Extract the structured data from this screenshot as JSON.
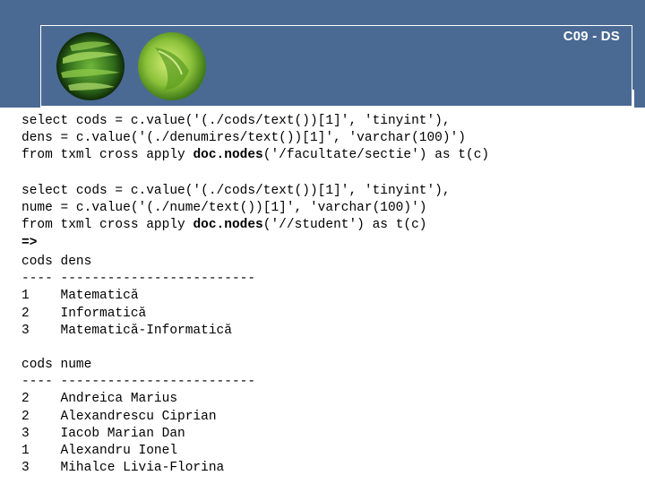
{
  "slide": {
    "title": "C09 - DS"
  },
  "query1": {
    "line1": "select cods = c.value('(./cods/text())[1]', 'tinyint'),",
    "line2": "dens = c.value('(./denumires/text())[1]', 'varchar(100)')",
    "line3_a": "from txml cross apply ",
    "line3_kw": "doc.nodes",
    "line3_b": "('/facultate/sectie') as t(c)"
  },
  "query2": {
    "line1": "select cods = c.value('(./cods/text())[1]', 'tinyint'),",
    "line2": "nume = c.value('(./nume/text())[1]', 'varchar(100)')",
    "line3_a": "from txml cross apply ",
    "line3_kw": "doc.nodes",
    "line3_b": "('//student') as t(c)",
    "arrow": "=>"
  },
  "result1": {
    "header": "cods dens",
    "separator": "---- -------------------------",
    "rows": [
      "1    Matematică",
      "2    Informatică",
      "3    Matematică-Informatică"
    ]
  },
  "result2": {
    "header": "cods nume",
    "separator": "---- -------------------------",
    "rows": [
      "2    Andreica Marius",
      "2    Alexandrescu Ciprian",
      "3    Iacob Marian Dan",
      "1    Alexandru Ionel",
      "3    Mihalce Livia-Florina"
    ]
  }
}
